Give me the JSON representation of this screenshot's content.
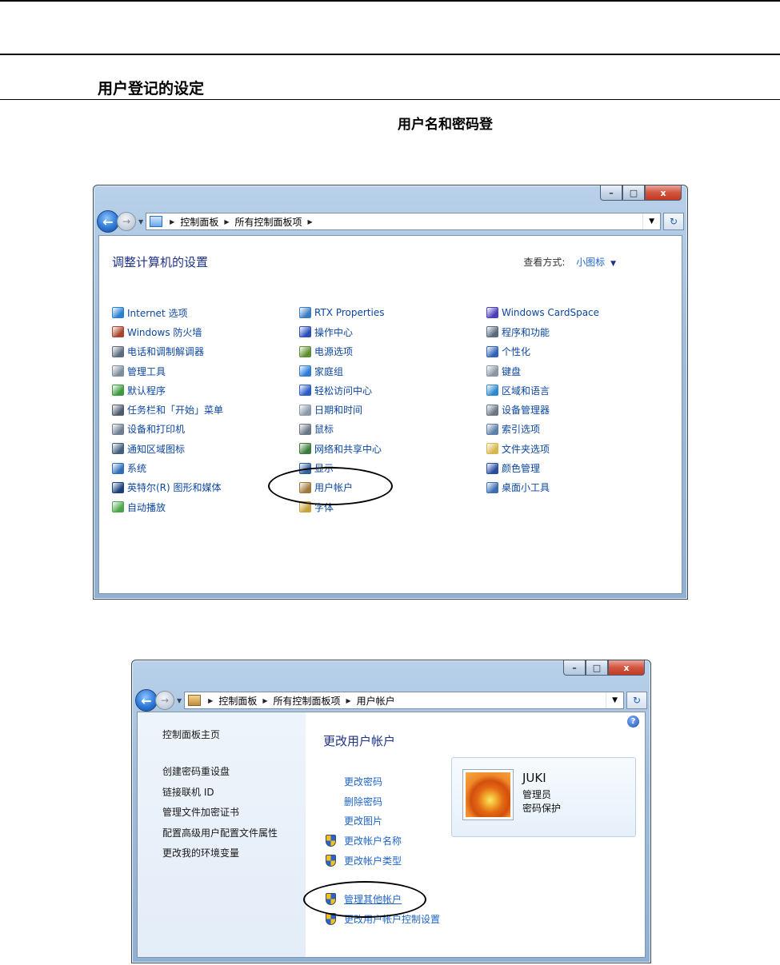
{
  "document": {
    "section_title": "用户登记的设定",
    "intro_text": "用户名和密码登"
  },
  "window1": {
    "caption": {
      "minimize": "–",
      "maximize": "□",
      "close": "x"
    },
    "breadcrumb": [
      "控制面板",
      "所有控制面板项"
    ],
    "heading": "调整计算机的设置",
    "view_by_label": "查看方式:",
    "view_by_value": "小图标",
    "columns": [
      [
        {
          "label": "Internet 选项",
          "icon": "globe-icon",
          "color": "#2a7fd0"
        },
        {
          "label": "Windows 防火墙",
          "icon": "firewall-icon",
          "color": "#a6442c"
        },
        {
          "label": "电话和调制解调器",
          "icon": "phone-icon",
          "color": "#5a6b7e"
        },
        {
          "label": "管理工具",
          "icon": "admin-tools-icon",
          "color": "#7d8c9c"
        },
        {
          "label": "默认程序",
          "icon": "default-programs-icon",
          "color": "#3c9a3c"
        },
        {
          "label": "任务栏和「开始」菜单",
          "icon": "taskbar-icon",
          "color": "#4d5b6a"
        },
        {
          "label": "设备和打印机",
          "icon": "printer-icon",
          "color": "#6f7f90"
        },
        {
          "label": "通知区域图标",
          "icon": "notification-icon",
          "color": "#43607e"
        },
        {
          "label": "系统",
          "icon": "system-icon",
          "color": "#2e6fb8"
        },
        {
          "label": "英特尔(R) 图形和媒体",
          "icon": "intel-graphics-icon",
          "color": "#1a3f7a"
        },
        {
          "label": "自动播放",
          "icon": "autoplay-icon",
          "color": "#4aa64a"
        }
      ],
      [
        {
          "label": "RTX Properties",
          "icon": "rtx-icon",
          "color": "#3a7cc4"
        },
        {
          "label": "操作中心",
          "icon": "flag-icon",
          "color": "#2a4fb8"
        },
        {
          "label": "电源选项",
          "icon": "power-icon",
          "color": "#5d8f2f"
        },
        {
          "label": "家庭组",
          "icon": "homegroup-icon",
          "color": "#2c7bd6"
        },
        {
          "label": "轻松访问中心",
          "icon": "ease-of-access-icon",
          "color": "#2a5bc8"
        },
        {
          "label": "日期和时间",
          "icon": "clock-icon",
          "color": "#8a98a8"
        },
        {
          "label": "鼠标",
          "icon": "mouse-icon",
          "color": "#6b7784"
        },
        {
          "label": "网络和共享中心",
          "icon": "network-icon",
          "color": "#3b7c3b"
        },
        {
          "label": "显示",
          "icon": "display-icon",
          "color": "#2d5f9e"
        },
        {
          "label": "用户帐户",
          "icon": "user-accounts-icon",
          "color": "#a0783c"
        },
        {
          "label": "字体",
          "icon": "fonts-icon",
          "color": "#c8a23a"
        }
      ],
      [
        {
          "label": "Windows CardSpace",
          "icon": "cardspace-icon",
          "color": "#4a3fb8"
        },
        {
          "label": "程序和功能",
          "icon": "programs-icon",
          "color": "#5a6b7e"
        },
        {
          "label": "个性化",
          "icon": "personalization-icon",
          "color": "#2f64b8"
        },
        {
          "label": "键盘",
          "icon": "keyboard-icon",
          "color": "#8a96a3"
        },
        {
          "label": "区域和语言",
          "icon": "region-icon",
          "color": "#2b8ad0"
        },
        {
          "label": "设备管理器",
          "icon": "device-manager-icon",
          "color": "#6b7784"
        },
        {
          "label": "索引选项",
          "icon": "indexing-icon",
          "color": "#5e7fa6"
        },
        {
          "label": "文件夹选项",
          "icon": "folder-icon",
          "color": "#d8b64a"
        },
        {
          "label": "颜色管理",
          "icon": "color-management-icon",
          "color": "#2a4c9e"
        },
        {
          "label": "桌面小工具",
          "icon": "gadgets-icon",
          "color": "#3b6fb0"
        }
      ]
    ]
  },
  "window2": {
    "caption": {
      "minimize": "–",
      "maximize": "□",
      "close": "x"
    },
    "breadcrumb": [
      "控制面板",
      "所有控制面板项",
      "用户帐户"
    ],
    "left_pane": {
      "home": "控制面板主页",
      "links": [
        "创建密码重设盘",
        "链接联机 ID",
        "管理文件加密证书",
        "配置高级用户配置文件属性",
        "更改我的环境变量"
      ]
    },
    "title": "更改用户帐户",
    "tasks": [
      {
        "label": "更改密码",
        "shield": false
      },
      {
        "label": "删除密码",
        "shield": false
      },
      {
        "label": "更改图片",
        "shield": false
      },
      {
        "label": "更改帐户名称",
        "shield": true
      },
      {
        "label": "更改帐户类型",
        "shield": true
      }
    ],
    "other_tasks": [
      {
        "label": "管理其他帐户",
        "shield": true
      },
      {
        "label": "更改用户帐户控制设置",
        "shield": true
      }
    ],
    "user": {
      "name": "JUKI",
      "role": "管理员",
      "status": "密码保护"
    },
    "help": "?"
  }
}
